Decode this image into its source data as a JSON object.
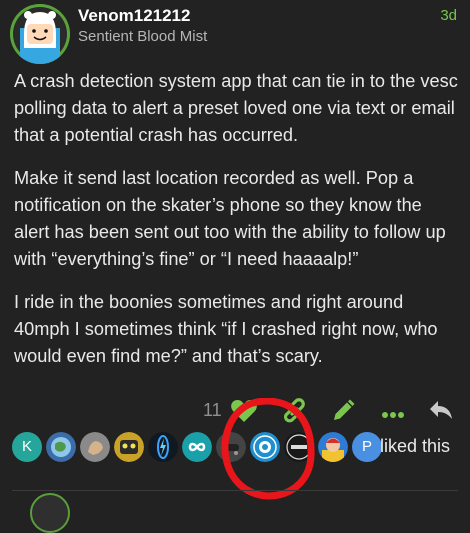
{
  "post": {
    "username": "Venom121212",
    "user_title": "Sentient Blood Mist",
    "date": "3d",
    "paragraphs": [
      "A crash detection system app that can tie in to the vesc polling data to alert a preset loved one via text or email that a potential crash has occurred.",
      "Make it send last location recorded as well. Pop a notification on the skater’s phone so they know the alert has been sent out too with the ability to follow up with “everything’s fine” or “I need haaaalp!”",
      "I ride in the boonies sometimes and right around 40mph I sometimes think “if I crashed right now, who would even find me?” and that’s scary."
    ],
    "like_count": "11",
    "liked_text": "liked this",
    "likers": [
      {
        "initial": "K",
        "color": "#26a69a"
      },
      {
        "initial": "",
        "color": "#3b6ea8"
      },
      {
        "initial": "",
        "color": "#8a8a8a"
      },
      {
        "initial": "",
        "color": "#c9a227"
      },
      {
        "initial": "",
        "color": "#101820"
      },
      {
        "initial": "",
        "color": "#1aa0a8"
      },
      {
        "initial": "",
        "color": "#444444"
      },
      {
        "initial": "",
        "color": "#1f8fd0"
      },
      {
        "initial": "",
        "color": "#181818"
      },
      {
        "initial": "",
        "color": "#d33030"
      },
      {
        "initial": "P",
        "color": "#4a90e2"
      }
    ]
  },
  "colors": {
    "accent_green": "#7bc64d",
    "annotation_red": "#e8151b"
  },
  "icons": [
    "heart-icon",
    "link-icon",
    "pencil-icon",
    "more-icon",
    "reply-icon"
  ]
}
